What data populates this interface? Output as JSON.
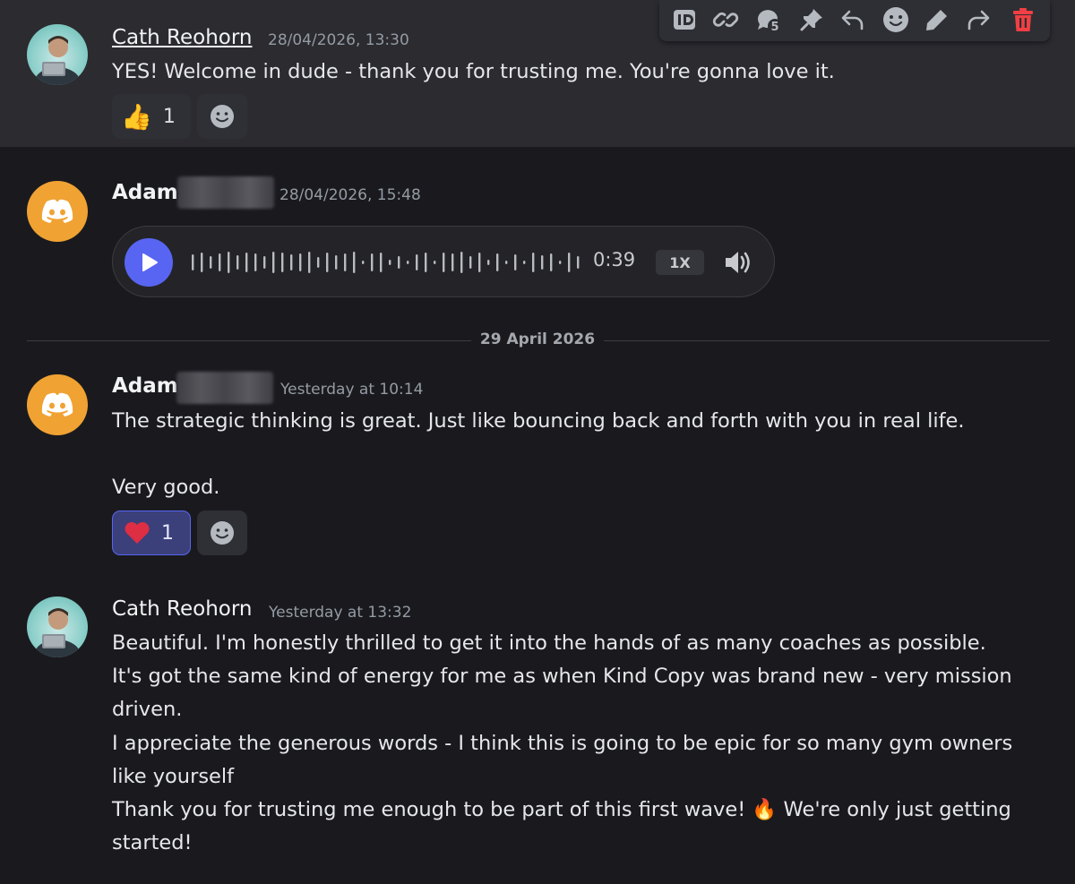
{
  "toolbar": {
    "buttons": [
      "id-icon",
      "link-icon",
      "thread-icon",
      "pin-icon",
      "reply-icon",
      "add-reaction-icon",
      "edit-icon",
      "forward-icon",
      "delete-icon"
    ],
    "colors": {
      "delete": "#f23f43"
    }
  },
  "messages": [
    {
      "author": "Cath Reohorn",
      "timestamp": "28/04/2026, 13:30",
      "lines": [
        "YES! Welcome in dude - thank you for trusting me. You're gonna love it."
      ],
      "reaction": {
        "emoji": "👍",
        "count": "1"
      }
    },
    {
      "author": "Adam",
      "timestamp": "28/04/2026, 15:48",
      "voice": {
        "duration": "0:39",
        "speed": "1X"
      }
    },
    {
      "author": "Adam",
      "timestamp": "Yesterday at 10:14",
      "lines": [
        "The strategic thinking is great. Just like bouncing back and forth with you in real life.",
        "",
        "Very good."
      ],
      "reaction": {
        "emoji": "❤️",
        "count": "1",
        "active": true
      }
    },
    {
      "author": "Cath Reohorn",
      "timestamp": "Yesterday at 13:32",
      "lines": [
        "Beautiful. I'm honestly thrilled to get it into the hands of as many coaches as possible.",
        "It's got the same kind of energy for me as when Kind Copy was brand new - very mission",
        "driven.",
        "I appreciate the generous words - I think this is going to be epic for so many gym owners",
        "like yourself",
        "Thank you for trusting me enough to be part of this first wave! 🔥 We're only just getting",
        "started!"
      ]
    }
  ],
  "date_divider": "29 April 2026",
  "colors": {
    "accent": "#5865f2",
    "background": "#1a1a1e",
    "hover_background": "#2b2b30",
    "discord_avatar": "#f0a232"
  }
}
